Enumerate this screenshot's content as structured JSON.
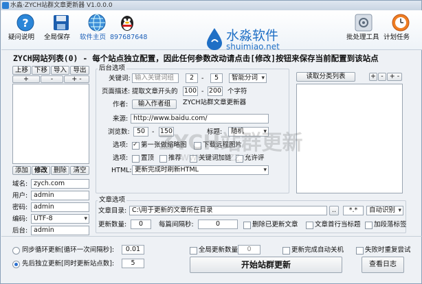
{
  "window": {
    "title": "水淼·ZYCH站群文章更新器 V1.0.0.0"
  },
  "toolbar": {
    "help": "疑问说明",
    "save_all": "全局保存",
    "homepage": "软件主页",
    "qq": "897687648",
    "batch_tools": "批处理工具",
    "schedule": "计划任务"
  },
  "logo": {
    "cn": "水淼软件",
    "en": "shuimiao.net"
  },
  "heading": "ZYCH网站列表(0) - 每个站点独立配置，因此任何参数改动请点击[修改]按钮来保存当前配置到该站点",
  "site_list": {
    "up": "上移",
    "down": "下移",
    "import": "导入",
    "export": "导出",
    "plus": "+",
    "minus": "-",
    "plusminus": "+ -",
    "add": "添加",
    "modify": "修改",
    "delete": "删除",
    "clear": "清空"
  },
  "site_form": {
    "domain_label": "域名:",
    "domain": "zych.com",
    "user_label": "用户:",
    "user": "admin",
    "password_label": "密码:",
    "password": "admin",
    "encoding_label": "编码:",
    "encoding": "UTF-8",
    "backend_label": "后台:",
    "backend": "admin"
  },
  "backend_options": {
    "title": "后台选项",
    "keyword_label": "关键词:",
    "keyword_placeholder": "输入关键词组",
    "kw_min": "2",
    "kw_dash": "-",
    "kw_max": "5",
    "kw_mode": "智能分词",
    "desc_label": "页面描述:",
    "desc_text": "提取文章开头的",
    "desc_min": "100",
    "desc_dash": "-",
    "desc_max": "200",
    "desc_unit": "个字符",
    "author_label": "作者:",
    "author_button": "输入作者组",
    "author_value": "ZYCH站群文章更新器",
    "source_label": "来源:",
    "source_value": "http://www.baidu.com/",
    "views_label": "浏览数:",
    "views_min": "50",
    "views_dash": "-",
    "views_max": "150",
    "title_label": "标题:",
    "title_mode": "随机",
    "options_label": "选项:",
    "opt_first_img": "第一张做缩略图",
    "opt_download_img": "下载远程图片",
    "options2_label": "选项:",
    "opt_top": "置顶",
    "opt_recommend": "推荐",
    "opt_keyword_link": "关键词加链",
    "opt_allow_comment": "允许评",
    "html_label": "HTML:",
    "html_mode": "更新完成时刷新HTML"
  },
  "category": {
    "read_button": "读取分类列表",
    "plus": "+",
    "minus": "-",
    "plusminus": "+ -"
  },
  "article_options": {
    "title": "文章选项",
    "dir_label": "文章目录:",
    "dir_value": "C:\\用于更新的文章所在目录",
    "browse": "..",
    "pattern": "*.*",
    "encoding_mode": "自动识别",
    "update_count_label": "更新数量:",
    "update_count": "0",
    "interval_label": "每篇间隔秒:",
    "interval": "0",
    "delete_updated": "删除已更新文章",
    "first_line_title": "文章首行当标题",
    "add_paragraph_tags": "加段落标签"
  },
  "bottom": {
    "sync_label": "同步循环更新[循环一次间隔秒]:",
    "sync_value": "0.01",
    "sequential_label": "先后独立更新[同时更新站点数]:",
    "sequential_value": "5",
    "global_count_label": "全局更新数量:",
    "global_count_value": "0",
    "shutdown_label": "更新完成自动关机",
    "retry_label": "失败时重复尝试",
    "start_button": "开始站群更新",
    "log_button": "查看日志"
  },
  "watermark": {
    "text": "ZYCH站群更新",
    "sub": "WWW.125UZZ.COM"
  },
  "colors": {
    "accent": "#1f6fc5",
    "title_bar": "#c9d5e3"
  }
}
